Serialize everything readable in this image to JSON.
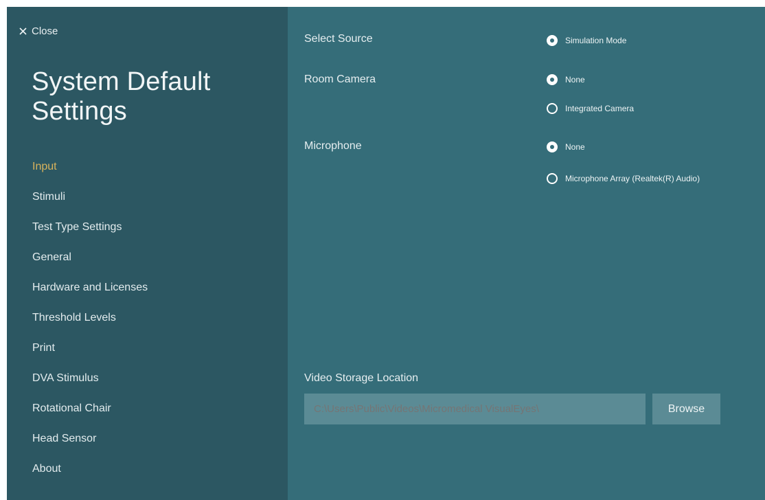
{
  "sidebar": {
    "close_label": "Close",
    "title_line1": "System Default",
    "title_line2": "Settings",
    "items": [
      {
        "label": "Input",
        "active": true
      },
      {
        "label": "Stimuli"
      },
      {
        "label": "Test Type Settings"
      },
      {
        "label": "General"
      },
      {
        "label": "Hardware and Licenses"
      },
      {
        "label": "Threshold Levels"
      },
      {
        "label": "Print"
      },
      {
        "label": "DVA Stimulus"
      },
      {
        "label": "Rotational Chair"
      },
      {
        "label": "Head Sensor"
      },
      {
        "label": "About"
      }
    ]
  },
  "main": {
    "select_source": {
      "label": "Select Source",
      "options": [
        {
          "label": "Simulation Mode",
          "selected": true
        }
      ]
    },
    "room_camera": {
      "label": "Room Camera",
      "options": [
        {
          "label": "None",
          "selected": true
        },
        {
          "label": "Integrated Camera",
          "selected": false
        }
      ]
    },
    "microphone": {
      "label": "Microphone",
      "options": [
        {
          "label": "None",
          "selected": true
        },
        {
          "label": "Microphone Array (Realtek(R) Audio)",
          "selected": false
        }
      ]
    },
    "video_storage": {
      "label": "Video Storage Location",
      "placeholder": "C:\\Users\\Public\\Videos\\Micromedical VisualEyes\\",
      "browse_label": "Browse"
    }
  },
  "colors": {
    "sidebar_bg": "#2c5762",
    "main_bg": "#356d79",
    "active_nav": "#d8b35c",
    "field_bg": "#5b8b95"
  },
  "icons": {
    "close": "close-icon"
  }
}
